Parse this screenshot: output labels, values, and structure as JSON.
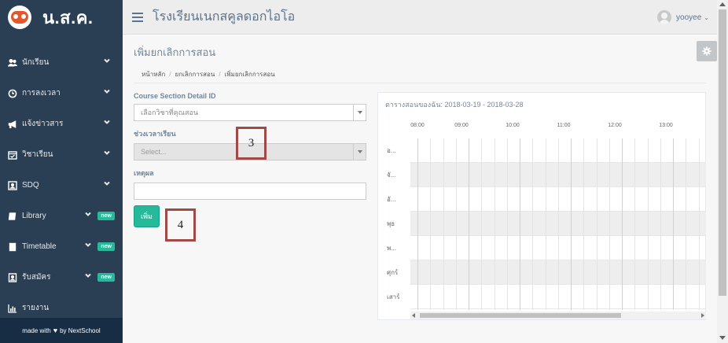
{
  "brand": {
    "name": "น.ส.ค."
  },
  "sidebar": {
    "items": [
      {
        "label": "นักเรียน",
        "icon": "users-icon",
        "badge": ""
      },
      {
        "label": "การลงเวลา",
        "icon": "clock-icon",
        "badge": ""
      },
      {
        "label": "แจ้งข่าวสาร",
        "icon": "bullhorn-icon",
        "badge": ""
      },
      {
        "label": "วิชาเรียน",
        "icon": "calendar-check-icon",
        "badge": ""
      },
      {
        "label": "SDQ",
        "icon": "id-card-icon",
        "badge": ""
      },
      {
        "label": "Library",
        "icon": "book-icon",
        "badge": "new"
      },
      {
        "label": "Timetable",
        "icon": "table-icon",
        "badge": "new"
      },
      {
        "label": "รับสมัคร",
        "icon": "id-badge-icon",
        "badge": "new"
      },
      {
        "label": "รายงาน",
        "icon": "bar-chart-icon",
        "badge": ""
      }
    ],
    "footer": {
      "prefix": "made with",
      "suffix": "by NextSchool"
    }
  },
  "topbar": {
    "school_name": "โรงเรียนเนกสคูลดอกไอโอ",
    "username": "yooyee"
  },
  "page": {
    "title": "เพิ่มยกเลิกการสอน",
    "breadcrumb": [
      "หน้าหลัก",
      "ยกเลิกการสอน",
      "เพิ่มยกเลิกการสอน"
    ]
  },
  "form": {
    "course_label": "Course Section Detail ID",
    "course_placeholder": "เลือกวิชาที่คุณสอน",
    "period_label": "ช่วงเวลาเรียน",
    "period_placeholder": "Select...",
    "reason_label": "เหตุผล",
    "reason_value": "",
    "submit_label": "เพิ่ม"
  },
  "callouts": [
    "3",
    "4"
  ],
  "timetable": {
    "title": "ตารางสอนของฉัน: 2018-03-19 - 2018-03-28",
    "hours": [
      "08:00",
      "09:00",
      "10:00",
      "11:00",
      "12:00",
      "13:00"
    ],
    "days": [
      "อ...",
      "จั...",
      "อั...",
      "พุธ",
      "พ...",
      "ศุกร์",
      "เสาร์"
    ]
  },
  "colors": {
    "sidebar": "#2a3f54",
    "accent": "#26b99a",
    "callout_border": "#9e4b48"
  }
}
